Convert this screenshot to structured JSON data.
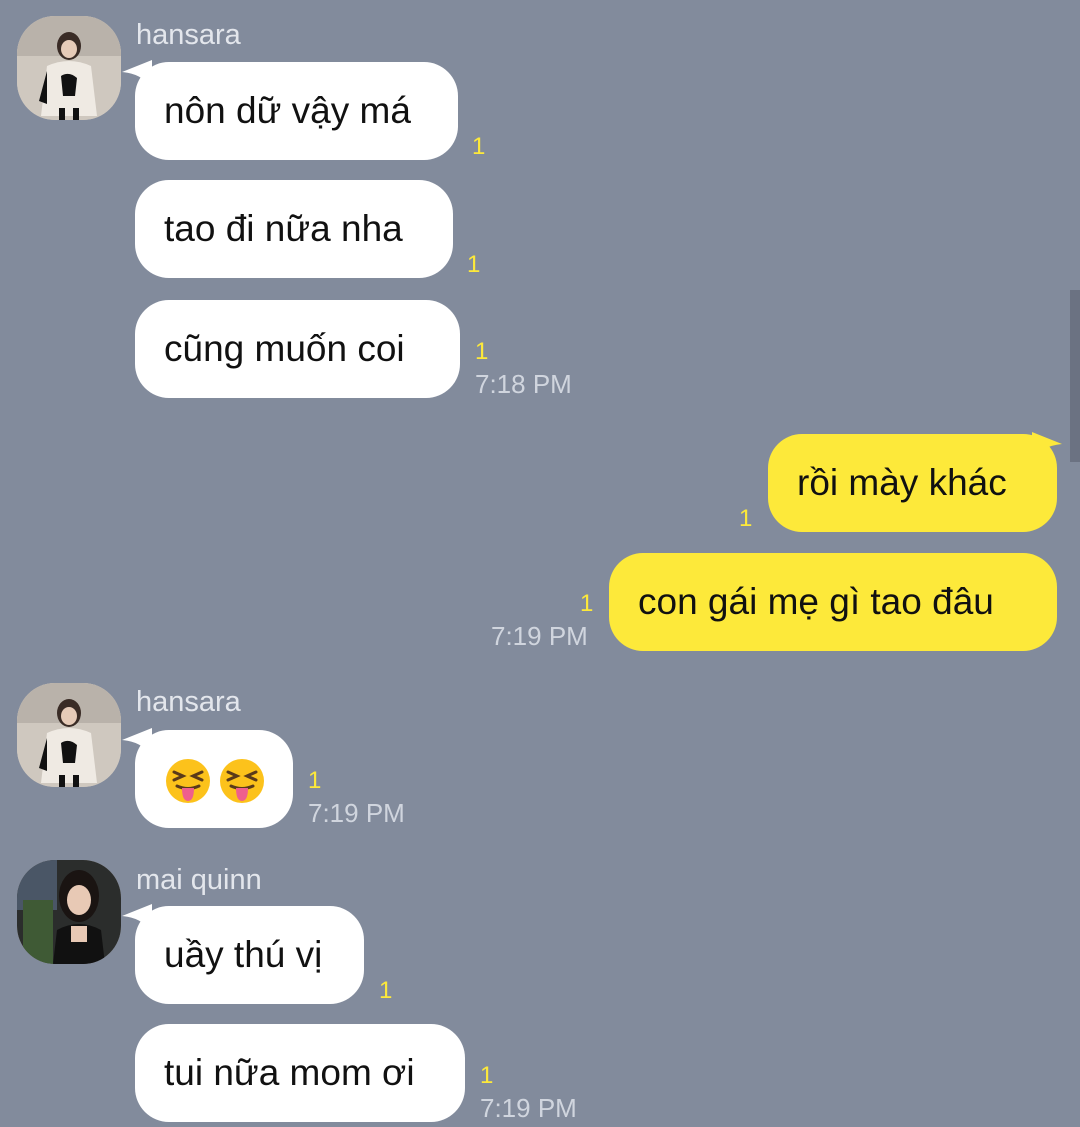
{
  "chat": {
    "groups": [
      {
        "sender": "hansara",
        "messages": [
          {
            "text": "nôn dữ vậy má",
            "read": "1"
          },
          {
            "text": "tao đi nữa nha",
            "read": "1"
          },
          {
            "text": "cũng muốn coi",
            "read": "1",
            "time": "7:18 PM"
          }
        ]
      },
      {
        "sender": "",
        "outgoing": true,
        "messages": [
          {
            "text": "rồi mày khác",
            "read": "1"
          },
          {
            "text": "con gái mẹ gì tao đâu",
            "read": "1",
            "time": "7:19 PM"
          }
        ]
      },
      {
        "sender": "hansara",
        "messages": [
          {
            "text": "",
            "emoji": [
              "squinting-tongue-emoji",
              "squinting-tongue-emoji"
            ],
            "read": "1",
            "time": "7:19 PM"
          }
        ]
      },
      {
        "sender": "mai quinn",
        "messages": [
          {
            "text": "uầy thú vị",
            "read": "1"
          },
          {
            "text": "tui nữa mom ơi",
            "read": "1",
            "time": "7:19 PM"
          }
        ]
      }
    ]
  },
  "colors": {
    "background": "#828b9c",
    "outgoing_bubble": "#fde93a",
    "incoming_bubble": "#ffffff",
    "read_count": "#fde93a"
  }
}
